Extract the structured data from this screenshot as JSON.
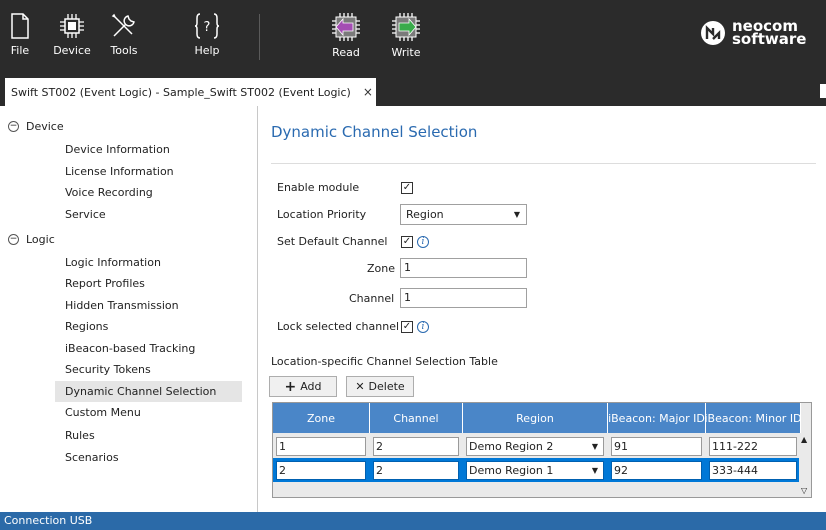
{
  "toolbar": {
    "buttons": [
      {
        "id": "file",
        "label": "File",
        "icon": "file-icon"
      },
      {
        "id": "device",
        "label": "Device",
        "icon": "chip-icon"
      },
      {
        "id": "tools",
        "label": "Tools",
        "icon": "tools-icon"
      },
      {
        "id": "help",
        "label": "Help",
        "icon": "help-icon"
      },
      {
        "id": "read",
        "label": "Read",
        "icon": "read-device-icon"
      },
      {
        "id": "write",
        "label": "Write",
        "icon": "write-device-icon"
      }
    ],
    "logo": {
      "line1": "neocom",
      "line2": "software"
    }
  },
  "tab": {
    "title": "Swift ST002 (Event Logic) - Sample_Swift ST002 (Event Logic)",
    "close": "×"
  },
  "sidebar": {
    "device_group": {
      "label": "Device",
      "toggle": "−"
    },
    "device_items": [
      "Device Information",
      "License Information",
      "Voice Recording",
      "Service"
    ],
    "logic_group": {
      "label": "Logic",
      "toggle": "−"
    },
    "logic_items": [
      "Logic Information",
      "Report Profiles",
      "Hidden Transmission",
      "Regions",
      "iBeacon-based Tracking",
      "Security Tokens",
      "Dynamic Channel Selection",
      "Custom Menu",
      "Rules",
      "Scenarios"
    ],
    "selected": "Dynamic Channel Selection"
  },
  "main": {
    "title": "Dynamic Channel Selection",
    "enable_module": {
      "label": "Enable module",
      "checked": true
    },
    "location_priority": {
      "label": "Location Priority",
      "value": "Region"
    },
    "set_default_channel": {
      "label": "Set Default Channel",
      "checked": true
    },
    "zone": {
      "label": "Zone",
      "value": "1"
    },
    "channel": {
      "label": "Channel",
      "value": "1"
    },
    "lock_selected_channel": {
      "label": "Lock selected channel",
      "checked": true
    },
    "table_title": "Location-specific Channel Selection Table",
    "add_button": {
      "icon": "+",
      "label": "Add"
    },
    "delete_button": {
      "icon": "✕",
      "label": "Delete"
    },
    "table": {
      "columns": [
        "Zone",
        "Channel",
        "Region",
        "iBeacon: Major ID",
        "iBeacon: Minor ID"
      ],
      "rows": [
        {
          "zone": "1",
          "channel": "2",
          "region": "Demo Region 2",
          "major": "91",
          "minor": "111-222",
          "selected": false
        },
        {
          "zone": "2",
          "channel": "2",
          "region": "Demo Region 1",
          "major": "92",
          "minor": "333-444",
          "selected": true
        }
      ]
    }
  },
  "status": {
    "text": "Connection USB"
  },
  "colors": {
    "accent": "#2a6ab0",
    "toolbar_bg": "#2b2b2b",
    "header_blue": "#4a86c8",
    "selection": "#0078d7",
    "status_bg": "#2b6aa8"
  }
}
